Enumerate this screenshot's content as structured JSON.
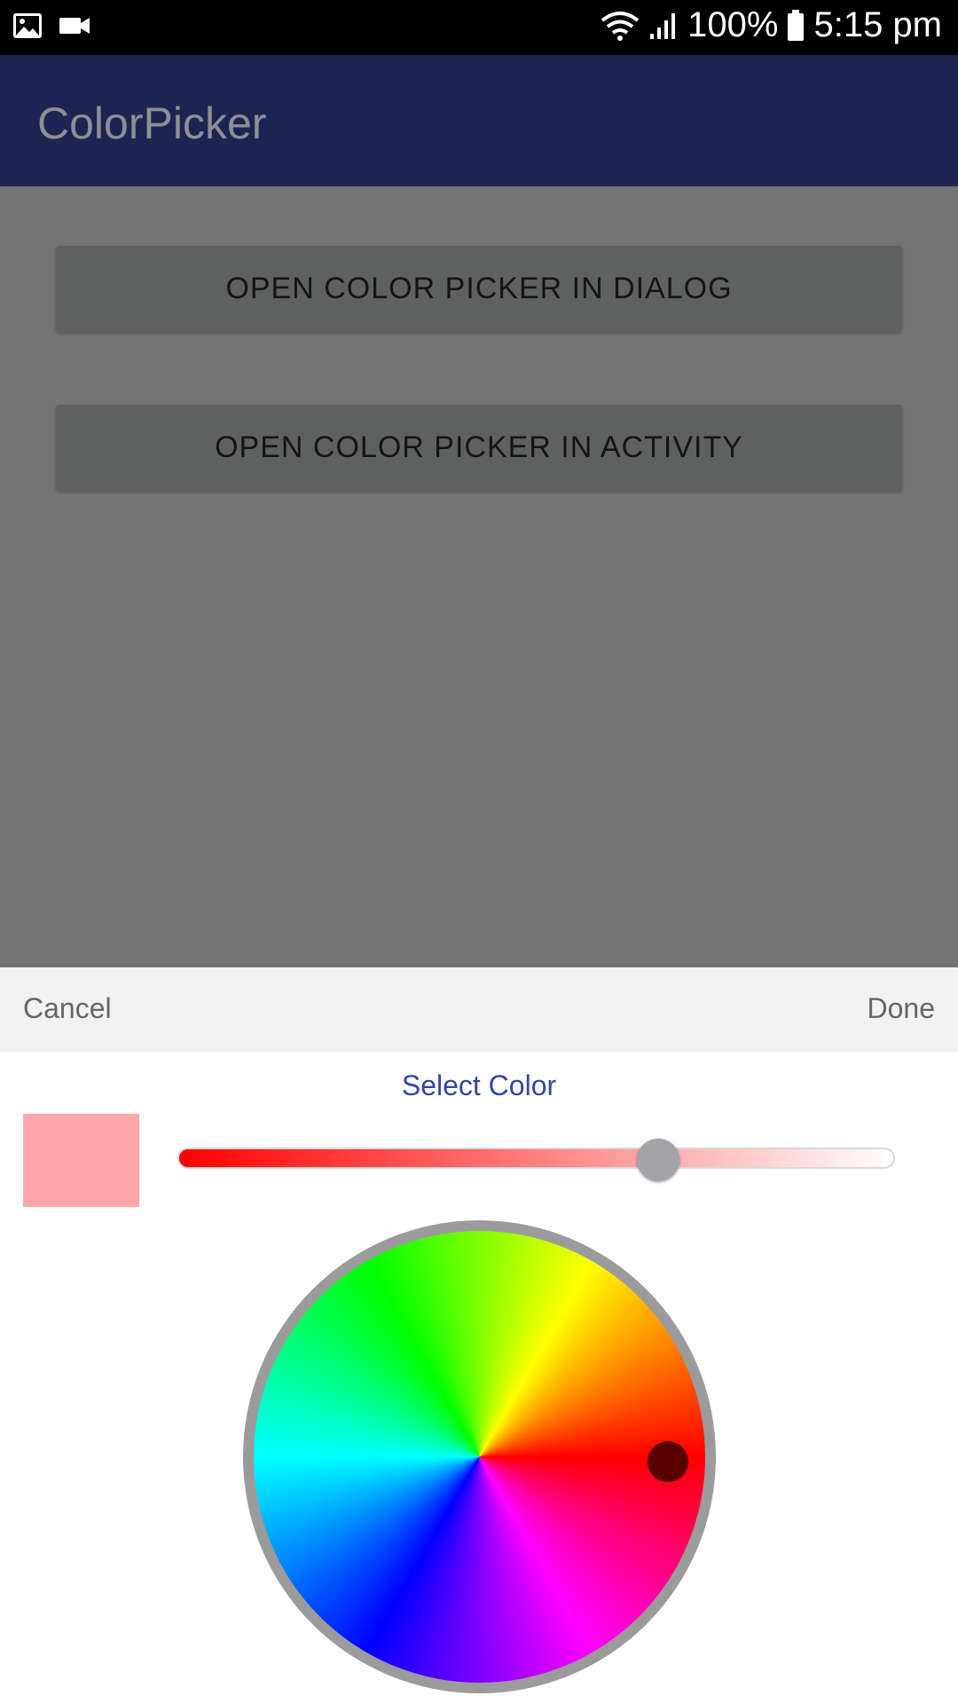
{
  "status_bar": {
    "battery": "100%",
    "time": "5:15 pm",
    "icons": [
      "gallery-icon",
      "video-camera-icon",
      "wifi-icon",
      "signal-icon",
      "battery-icon"
    ]
  },
  "app_bar": {
    "title": "ColorPicker"
  },
  "main": {
    "dialog_button_label": "OPEN COLOR PICKER IN DIALOG",
    "activity_button_label": "OPEN COLOR PICKER IN ACTIVITY"
  },
  "picker": {
    "cancel_label": "Cancel",
    "done_label": "Done",
    "title": "Select Color",
    "selected_color": "#ffa6aa",
    "saturation_level_percent": 67,
    "hue_handle_color": "#5a0000",
    "accent_color": "#3344aa"
  }
}
